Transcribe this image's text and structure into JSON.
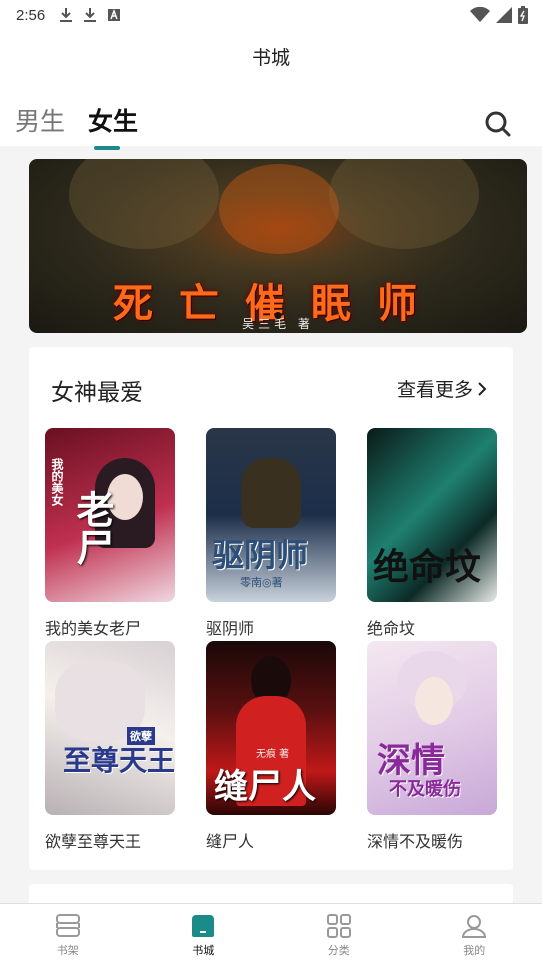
{
  "status": {
    "time": "2:56"
  },
  "header": {
    "title": "书城"
  },
  "tabs": [
    {
      "label": "男生"
    },
    {
      "label": "女生"
    }
  ],
  "banner": {
    "title": "死亡催眠师",
    "author": "吴三毛 著"
  },
  "section": {
    "title": "女神最爱",
    "more": "查看更多",
    "books": [
      {
        "title": "我的美女老尸",
        "cover_text": "老尸",
        "cover_sub": "我的美女",
        "cover_colors": [
          "#6a1020",
          "#c03050"
        ]
      },
      {
        "title": "驱阴师",
        "cover_text": "驱阴师",
        "cover_sub": "零南◎著",
        "cover_colors": [
          "#1c2e4a",
          "#3a5a80"
        ]
      },
      {
        "title": "绝命坟",
        "cover_text": "绝命坟",
        "cover_sub": "",
        "cover_colors": [
          "#0a1a18",
          "#1f8070"
        ]
      },
      {
        "title": "欲孽至尊天王",
        "cover_text": "至尊天王",
        "cover_sub": "欲孽",
        "cover_colors": [
          "#f5f0ec",
          "#b8b0b4"
        ]
      },
      {
        "title": "缝尸人",
        "cover_text": "缝尸人",
        "cover_sub": "无痕 著",
        "cover_colors": [
          "#1a0808",
          "#c01818"
        ]
      },
      {
        "title": "深情不及暖伤",
        "cover_text": "深情",
        "cover_sub": "不及暖伤",
        "cover_colors": [
          "#f4e8f0",
          "#c8a8d8"
        ]
      }
    ]
  },
  "nav": [
    {
      "label": "书架",
      "icon": "bookshelf-icon"
    },
    {
      "label": "书城",
      "icon": "bookstore-icon"
    },
    {
      "label": "分类",
      "icon": "category-icon"
    },
    {
      "label": "我的",
      "icon": "profile-icon"
    }
  ],
  "colors": {
    "accent": "#1b8b8a"
  }
}
